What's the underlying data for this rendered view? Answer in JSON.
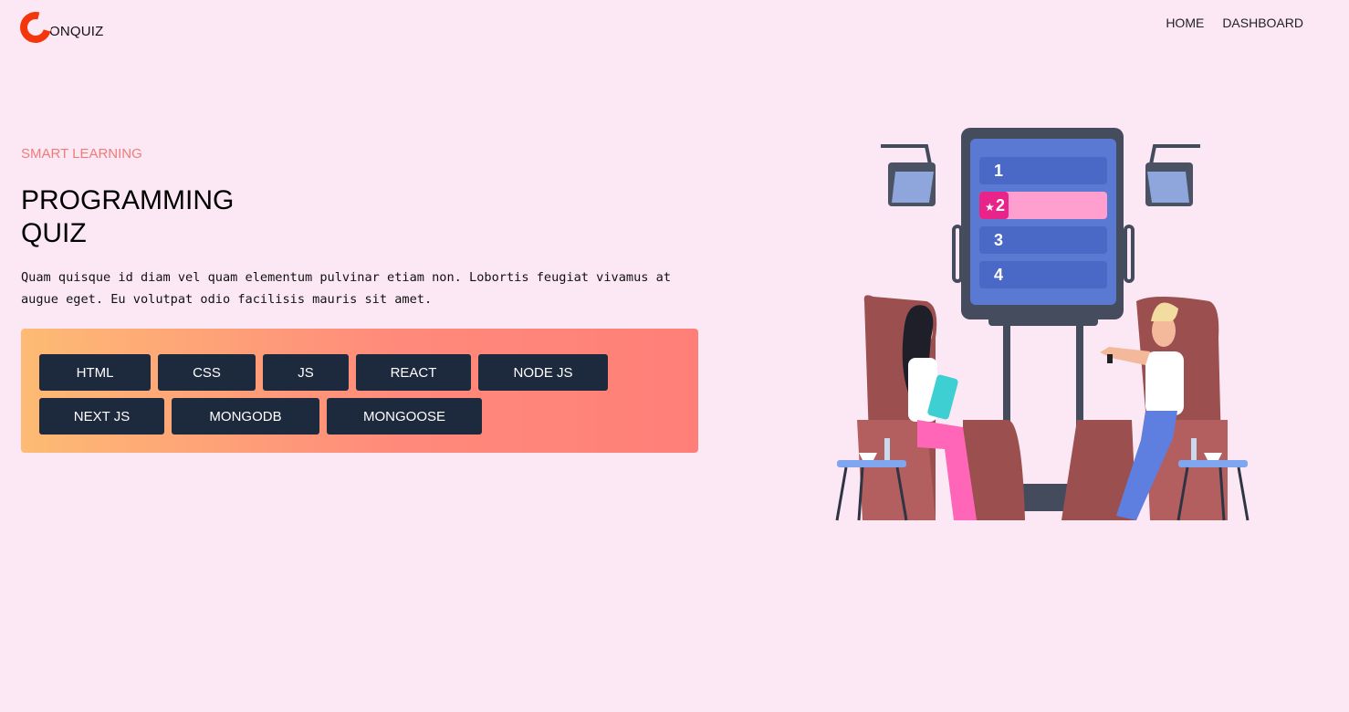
{
  "brand": {
    "name": "ONQUIZ",
    "display": "ONQUIZ",
    "accent": "#f3360c"
  },
  "nav": [
    {
      "label": "HOME"
    },
    {
      "label": "DASHBOARD"
    }
  ],
  "hero": {
    "eyebrow": "SMART LEARNING",
    "title": "PROGRAMMING QUIZ",
    "description": "Quam quisque id diam vel quam elementum pulvinar etiam non. Lobortis feugiat vivamus at augue eget. Eu volutpat odio facilisis mauris sit amet."
  },
  "topics": [
    {
      "label": "HTML"
    },
    {
      "label": "CSS"
    },
    {
      "label": "JS"
    },
    {
      "label": "REACT"
    },
    {
      "label": "NODE JS"
    },
    {
      "label": "NEXT JS"
    },
    {
      "label": "MONGODB"
    },
    {
      "label": "MONGOOSE"
    }
  ],
  "illustration": {
    "board_items": [
      "1",
      "2",
      "3",
      "4"
    ],
    "highlighted_item": "2"
  },
  "colors": {
    "background": "#fce8f4",
    "chip": "#1d293d",
    "eyebrow": "#f07b78"
  }
}
